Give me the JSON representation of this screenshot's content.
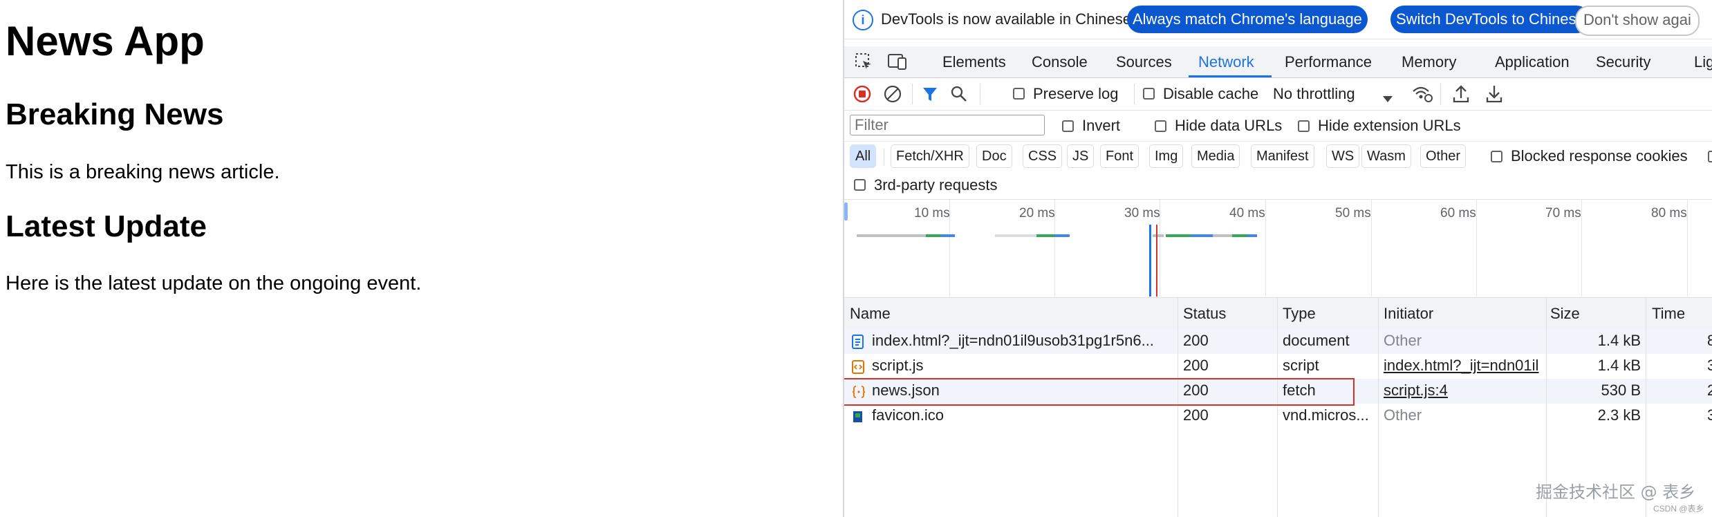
{
  "page": {
    "title": "News App",
    "heading_breaking": "Breaking News",
    "text_breaking": "This is a breaking news article.",
    "heading_latest": "Latest Update",
    "text_latest": "Here is the latest update on the ongoing event."
  },
  "devtools": {
    "infobar": {
      "message": "DevTools is now available in Chinese!",
      "btn_match": "Always match Chrome's language",
      "btn_switch": "Switch DevTools to Chinese",
      "btn_dismiss": "Don't show agai"
    },
    "tabs": [
      "Elements",
      "Console",
      "Sources",
      "Network",
      "Performance",
      "Memory",
      "Application",
      "Security",
      "Lig"
    ],
    "active_tab": "Network",
    "toolbar": {
      "preserve_log": "Preserve log",
      "disable_cache": "Disable cache",
      "throttling": "No throttling"
    },
    "filter": {
      "placeholder": "Filter",
      "invert": "Invert",
      "hide_data_urls": "Hide data URLs",
      "hide_extension_urls": "Hide extension URLs"
    },
    "type_filters": [
      "All",
      "Fetch/XHR",
      "Doc",
      "CSS",
      "JS",
      "Font",
      "Img",
      "Media",
      "Manifest",
      "WS",
      "Wasm",
      "Other"
    ],
    "blocked_cookies": "Blocked response cookies",
    "third_party": "3rd-party requests",
    "timeline_ticks": [
      "10 ms",
      "20 ms",
      "30 ms",
      "40 ms",
      "50 ms",
      "60 ms",
      "70 ms",
      "80 ms"
    ],
    "columns": [
      "Name",
      "Status",
      "Type",
      "Initiator",
      "Size",
      "Time"
    ],
    "rows": [
      {
        "name": "index.html?_ijt=ndn01il9usob31pg1r5n6...",
        "status": "200",
        "type": "document",
        "initiator": "Other",
        "size": "1.4 kB",
        "time": "8",
        "icon": "document-icon"
      },
      {
        "name": "script.js",
        "status": "200",
        "type": "script",
        "initiator": "index.html?_ijt=ndn01il",
        "size": "1.4 kB",
        "time": "3",
        "icon": "script-icon"
      },
      {
        "name": "news.json",
        "status": "200",
        "type": "fetch",
        "initiator": "script.js:4",
        "size": "530 B",
        "time": "2",
        "icon": "json-icon"
      },
      {
        "name": "favicon.ico",
        "status": "200",
        "type": "vnd.micros...",
        "initiator": "Other",
        "size": "2.3 kB",
        "time": "3",
        "icon": "favicon-icon"
      }
    ],
    "colors": {
      "accent": "#1a73e8",
      "primary_button": "#0b57d0",
      "highlight": "#d93025",
      "record": "#d93025"
    }
  },
  "watermark": {
    "main": "掘金技术社区 @ 表乡",
    "sub": "CSDN @表乡"
  }
}
